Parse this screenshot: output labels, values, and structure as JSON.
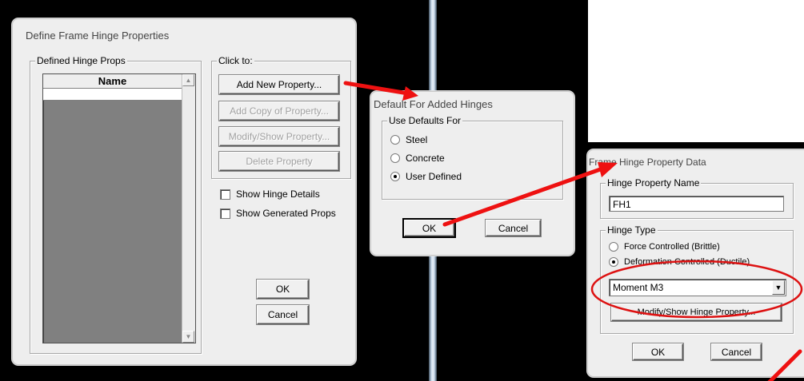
{
  "dialog1": {
    "title": "Define Frame Hinge Properties",
    "defined_group": "Defined Hinge Props",
    "list_header": "Name",
    "click_group": "Click to:",
    "buttons": {
      "add_new": "Add New Property...",
      "add_copy": "Add Copy of Property...",
      "modify": "Modify/Show Property...",
      "delete": "Delete Property"
    },
    "checks": {
      "show_details": "Show Hinge Details",
      "show_generated": "Show Generated Props"
    },
    "ok": "OK",
    "cancel": "Cancel"
  },
  "dialog2": {
    "title": "Default For Added Hinges",
    "group": "Use Defaults For",
    "options": [
      "Steel",
      "Concrete",
      "User Defined"
    ],
    "selected": "User Defined",
    "ok": "OK",
    "cancel": "Cancel"
  },
  "dialog3": {
    "title": "Frame Hinge Property Data",
    "name_group": "Hinge Property Name",
    "name_value": "FH1",
    "type_group": "Hinge Type",
    "option_force": "Force Controlled  (Brittle)",
    "option_deformation": "Deformation Controlled  (Ductile)",
    "selected": "Deformation Controlled  (Ductile)",
    "dof_value": "Moment M3",
    "modify_button": "Modify/Show Hinge Property...",
    "ok": "OK",
    "cancel": "Cancel"
  },
  "colors": {
    "arrow": "#ee1111",
    "highlight_ellipse": "#dd1111",
    "separator": "#c6d8ea"
  }
}
